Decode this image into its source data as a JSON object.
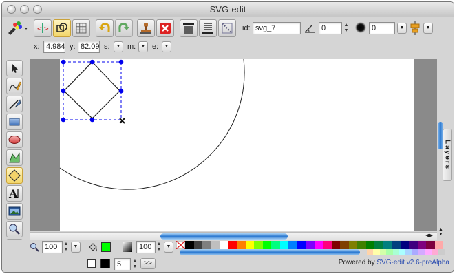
{
  "window": {
    "title": "SVG-edit"
  },
  "top_panel": {
    "id_label": "id:",
    "id_value": "svg_7",
    "angle_value": "0",
    "blur_value": "0"
  },
  "position_panel": {
    "x_label": "x:",
    "x_value": "4.984",
    "y_label": "y:",
    "y_value": "82.09",
    "s_label": "s:",
    "m_label": "m:",
    "e_label": "e:"
  },
  "layers": {
    "label": "Layers"
  },
  "bottom_panel": {
    "zoom_value": "100",
    "opacity_value": "100",
    "stroke_width_value": "5",
    "more_label": ">>",
    "powered_by": "Powered by",
    "powered_link": "SVG-edit v2.6-preAlpha"
  },
  "colors": {
    "fill": "#00ff00",
    "stroke": "#000000",
    "selection": "#0000ee"
  },
  "palette_row1": [
    "#000000",
    "#3f3f3f",
    "#7f7f7f",
    "#bfbfbf",
    "#ffffff",
    "#ff0000",
    "#ff7f00",
    "#ffff00",
    "#7fff00",
    "#00ff00",
    "#00ff7f",
    "#00ffff",
    "#007fff",
    "#0000ff",
    "#7f00ff",
    "#ff00ff",
    "#ff007f",
    "#7f0000",
    "#7f3f00",
    "#7f7f00",
    "#3f7f00",
    "#007f00",
    "#007f3f",
    "#007f7f",
    "#003f7f",
    "#00007f",
    "#3f007f",
    "#7f007f",
    "#7f003f",
    "#ffaaaa"
  ],
  "palette_row2": [
    "#ffd4aa",
    "#ffffaa",
    "#d4ffaa",
    "#aaffaa",
    "#aaffd4",
    "#aaffff",
    "#aad4ff",
    "#aaaaff",
    "#d4aaff",
    "#ffaaff",
    "#ffaad4",
    "#cccccc"
  ]
}
